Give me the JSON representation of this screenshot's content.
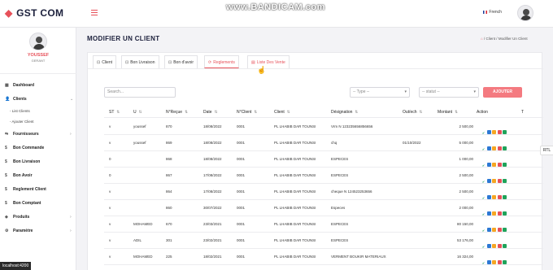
{
  "app": {
    "logo_text": "GST COM",
    "logo_mark": "◆"
  },
  "watermark": "www.BANDICAM.com",
  "header": {
    "language": "French",
    "flag_icon": "france-flag-icon"
  },
  "sidebar": {
    "user_name": "YOUSSEF",
    "user_role": "GERANT",
    "items": [
      {
        "label": "Dashboard",
        "icon": "▦"
      },
      {
        "label": "Clients",
        "icon": "👤",
        "chevron": "⌄"
      },
      {
        "label": "Fournisseurs",
        "icon": "⇆",
        "chevron": "›"
      },
      {
        "label": "Bon Commande",
        "icon": "$"
      },
      {
        "label": "Bon Livraison",
        "icon": "$"
      },
      {
        "label": "Bon Avoir",
        "icon": "$"
      },
      {
        "label": "Reglement Client",
        "icon": "$"
      },
      {
        "label": "Bon Comptant",
        "icon": "$"
      },
      {
        "label": "Produits",
        "icon": "◈",
        "chevron": "›"
      },
      {
        "label": "Paramètre",
        "icon": "⚙",
        "chevron": "›"
      }
    ],
    "sub_items": [
      "- List Clients",
      "- Ajouter Client"
    ]
  },
  "page": {
    "title": "MODIFIER UN CLIENT",
    "breadcrumb": {
      "home": "⌂",
      "sep1": "/",
      "item1": "Client",
      "sep2": "/",
      "item2": "Modifier Un Client"
    }
  },
  "tabs": [
    {
      "label": "Client",
      "icon": "⊡"
    },
    {
      "label": "Bon Livraison",
      "icon": "⊡"
    },
    {
      "label": "Bon d'avoir",
      "icon": "⊡"
    },
    {
      "label": "Reglements",
      "icon": "⟳"
    },
    {
      "label": "Liste Des Vente",
      "icon": "▤"
    }
  ],
  "filters": {
    "search_placeholder": "Search...",
    "type_placeholder": "-- Type --",
    "statut_placeholder": "-- statut --",
    "add_button": "AJOUTER"
  },
  "table": {
    "headers": [
      {
        "label": "ST",
        "sort": "⇅"
      },
      {
        "label": "U",
        "sort": "⇅"
      },
      {
        "label": "N°Reçue",
        "sort": "⇅"
      },
      {
        "label": "Date",
        "sort": "⇅"
      },
      {
        "label": "N°Client",
        "sort": "⇅"
      },
      {
        "label": "Client",
        "sort": "⇅"
      },
      {
        "label": "Désignation",
        "sort": "⇅"
      },
      {
        "label": "Out/ech",
        "sort": "⇅"
      },
      {
        "label": "Montant",
        "sort": "⇅"
      },
      {
        "label": "Action",
        "sort": ""
      },
      {
        "label": "T",
        "sort": ""
      }
    ],
    "rows": [
      {
        "st": "v",
        "u": "youssef",
        "recu": "870",
        "date": "18/08/2022",
        "nclient": "0001",
        "client": "PL LHABIB DAR TOUNSI",
        "designation": "Vrm N 123235656856656",
        "outech": "",
        "montant": "2 500,00"
      },
      {
        "st": "v",
        "u": "youssef",
        "recu": "869",
        "date": "18/08/2022",
        "nclient": "0001",
        "client": "PL LHABIB DAR TOUNSI",
        "designation": "chq",
        "outech": "01/10/2022",
        "montant": "5 000,00"
      },
      {
        "st": "0",
        "u": "",
        "recu": "868",
        "date": "18/08/2022",
        "nclient": "0001",
        "client": "PL LHABIB DAR TOUNSI",
        "designation": "ESPECES",
        "outech": "",
        "montant": "1 000,00"
      },
      {
        "st": "0",
        "u": "",
        "recu": "867",
        "date": "17/08/2022",
        "nclient": "0001",
        "client": "PL LHABIB DAR TOUNSI",
        "designation": "ESPECES",
        "outech": "",
        "montant": "2 500,00"
      },
      {
        "st": "v",
        "u": "",
        "recu": "864",
        "date": "17/08/2022",
        "nclient": "0001",
        "client": "PL LHABIB DAR TOUNSI",
        "designation": "cheque N 124523253656",
        "outech": "",
        "montant": "2 500,00"
      },
      {
        "st": "v",
        "u": "",
        "recu": "860",
        "date": "30/07/2022",
        "nclient": "0001",
        "client": "PL LHABIB DAR TOUNSI",
        "designation": "Especes",
        "outech": "",
        "montant": "2 000,00"
      },
      {
        "st": "v",
        "u": "MOHAMED",
        "recu": "670",
        "date": "23/03/2021",
        "nclient": "0001",
        "client": "PL LHABIB DAR TOUNSI",
        "designation": "ESPECES",
        "outech": "",
        "montant": "80 150,00"
      },
      {
        "st": "v",
        "u": "ADIL",
        "recu": "301",
        "date": "23/02/2021",
        "nclient": "0001",
        "client": "PL LHABIB DAR TOUNSI",
        "designation": "ESPECES",
        "outech": "",
        "montant": "53 176,00"
      },
      {
        "st": "v",
        "u": "MOHAMED",
        "recu": "225",
        "date": "18/02/2021",
        "nclient": "0001",
        "client": "PL LHABIB DAR TOUNSI",
        "designation": "VERMENT BOUKIR MATERIAUX",
        "outech": "",
        "montant": "16 324,00"
      }
    ]
  },
  "rtl_label": "RTL",
  "status_url": "localhost:4200",
  "colors": {
    "accent": "#e7515a",
    "brand": "#1b1f3b",
    "add_button": "#f47a80"
  }
}
